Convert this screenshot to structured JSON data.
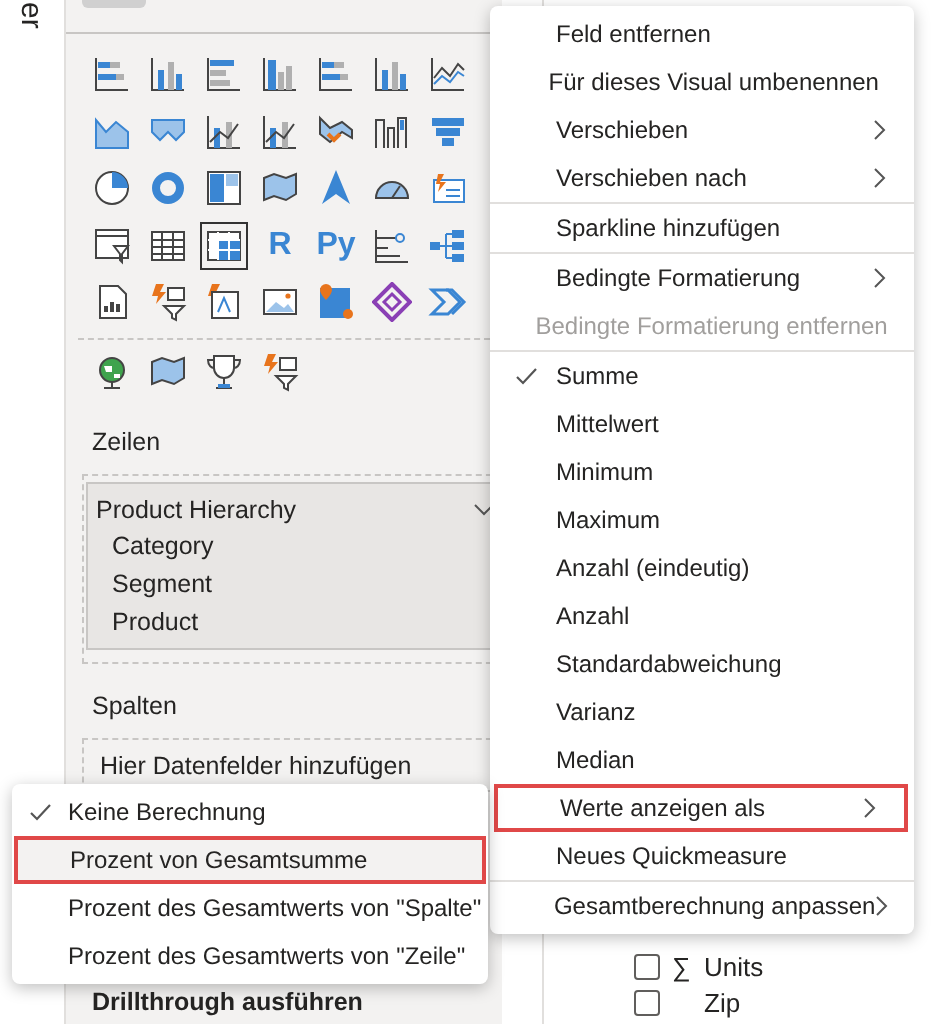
{
  "side_tab": {
    "label": "er"
  },
  "visuals": [
    {
      "kind": "hbar",
      "selected": false
    },
    {
      "kind": "col",
      "selected": false
    },
    {
      "kind": "hbar2",
      "selected": false
    },
    {
      "kind": "col2",
      "selected": false
    },
    {
      "kind": "hbar",
      "selected": false
    },
    {
      "kind": "col",
      "selected": false
    },
    {
      "kind": "line",
      "selected": false
    },
    {
      "kind": "area",
      "selected": false
    },
    {
      "kind": "area2",
      "selected": false
    },
    {
      "kind": "combo",
      "selected": false
    },
    {
      "kind": "combo",
      "selected": false
    },
    {
      "kind": "ribbon",
      "selected": false
    },
    {
      "kind": "waterfall",
      "selected": false
    },
    {
      "kind": "funnel",
      "selected": false
    },
    {
      "kind": "pie",
      "selected": false
    },
    {
      "kind": "donut",
      "selected": false
    },
    {
      "kind": "treemap",
      "selected": false
    },
    {
      "kind": "map",
      "selected": false
    },
    {
      "kind": "arrow",
      "selected": false
    },
    {
      "kind": "gauge",
      "selected": false
    },
    {
      "kind": "card",
      "selected": false
    },
    {
      "kind": "slicer",
      "selected": false
    },
    {
      "kind": "table",
      "selected": false
    },
    {
      "kind": "matrix",
      "selected": true
    },
    {
      "kind": "letter",
      "label": "R",
      "selected": false
    },
    {
      "kind": "letter",
      "label": "Py",
      "selected": false
    },
    {
      "kind": "influencers",
      "selected": false
    },
    {
      "kind": "tree",
      "selected": false
    },
    {
      "kind": "report",
      "selected": false
    },
    {
      "kind": "bolt-slicer",
      "selected": false
    },
    {
      "kind": "bolt-text",
      "selected": false
    },
    {
      "kind": "image",
      "selected": false
    },
    {
      "kind": "pin",
      "selected": false
    },
    {
      "kind": "diamond",
      "selected": false
    },
    {
      "kind": "chevrons",
      "selected": false
    },
    {
      "kind": "globe",
      "selected": false
    },
    {
      "kind": "map",
      "selected": false
    },
    {
      "kind": "trophy",
      "selected": false
    },
    {
      "kind": "bolt-slicer",
      "selected": false
    }
  ],
  "wells": [
    {
      "title": "Zeilen",
      "fields": [
        {
          "label": "Product Hierarchy",
          "expanded": true,
          "children": [
            {
              "label": "Category"
            },
            {
              "label": "Segment"
            },
            {
              "label": "Product"
            }
          ]
        }
      ]
    },
    {
      "title": "Spalten",
      "placeholder": "Hier Datenfelder hinzufügen"
    }
  ],
  "drillthrough": {
    "title": "Drillthrough ausführen"
  },
  "field_list": [
    {
      "symbol": "∑",
      "label": "Units",
      "checked": false
    },
    {
      "label": "Zip",
      "checked": false
    }
  ],
  "context_menu": {
    "groups": [
      [
        {
          "label": "Feld entfernen",
          "checked": false,
          "has_submenu": false,
          "disabled": false,
          "highlighted": false
        },
        {
          "label": "Für dieses Visual umbenennen",
          "checked": false,
          "has_submenu": false,
          "disabled": false,
          "highlighted": false
        },
        {
          "label": "Verschieben",
          "checked": false,
          "has_submenu": true,
          "disabled": false,
          "highlighted": false
        },
        {
          "label": "Verschieben nach",
          "checked": false,
          "has_submenu": true,
          "disabled": false,
          "highlighted": false
        }
      ],
      [
        {
          "label": "Sparkline hinzufügen",
          "checked": false,
          "has_submenu": false,
          "disabled": false,
          "highlighted": false
        }
      ],
      [
        {
          "label": "Bedingte Formatierung",
          "checked": false,
          "has_submenu": true,
          "disabled": false,
          "highlighted": false
        },
        {
          "label": "Bedingte Formatierung entfernen",
          "checked": false,
          "has_submenu": false,
          "disabled": true,
          "highlighted": false
        }
      ],
      [
        {
          "label": "Summe",
          "checked": true,
          "has_submenu": false,
          "disabled": false,
          "highlighted": false
        },
        {
          "label": "Mittelwert",
          "checked": false,
          "has_submenu": false,
          "disabled": false,
          "highlighted": false
        },
        {
          "label": "Minimum",
          "checked": false,
          "has_submenu": false,
          "disabled": false,
          "highlighted": false
        },
        {
          "label": "Maximum",
          "checked": false,
          "has_submenu": false,
          "disabled": false,
          "highlighted": false
        },
        {
          "label": "Anzahl (eindeutig)",
          "checked": false,
          "has_submenu": false,
          "disabled": false,
          "highlighted": false
        },
        {
          "label": "Anzahl",
          "checked": false,
          "has_submenu": false,
          "disabled": false,
          "highlighted": false
        },
        {
          "label": "Standardabweichung",
          "checked": false,
          "has_submenu": false,
          "disabled": false,
          "highlighted": false
        },
        {
          "label": "Varianz",
          "checked": false,
          "has_submenu": false,
          "disabled": false,
          "highlighted": false
        },
        {
          "label": "Median",
          "checked": false,
          "has_submenu": false,
          "disabled": false,
          "highlighted": false
        },
        {
          "label": "Werte anzeigen als",
          "checked": false,
          "has_submenu": true,
          "disabled": false,
          "highlighted": true
        },
        {
          "label": "Neues Quickmeasure",
          "checked": false,
          "has_submenu": false,
          "disabled": false,
          "highlighted": false
        }
      ],
      [
        {
          "label": "Gesamtberechnung anpassen",
          "checked": false,
          "has_submenu": true,
          "disabled": false,
          "highlighted": false
        }
      ]
    ]
  },
  "submenu": {
    "items": [
      {
        "label": "Keine Berechnung",
        "checked": true,
        "highlighted": false
      },
      {
        "label": "Prozent von Gesamtsumme",
        "checked": false,
        "highlighted": true
      },
      {
        "label": "Prozent des Gesamtwerts von \"Spalte\"",
        "checked": false,
        "highlighted": false
      },
      {
        "label": "Prozent des Gesamtwerts von \"Zeile\"",
        "checked": false,
        "highlighted": false
      }
    ]
  }
}
